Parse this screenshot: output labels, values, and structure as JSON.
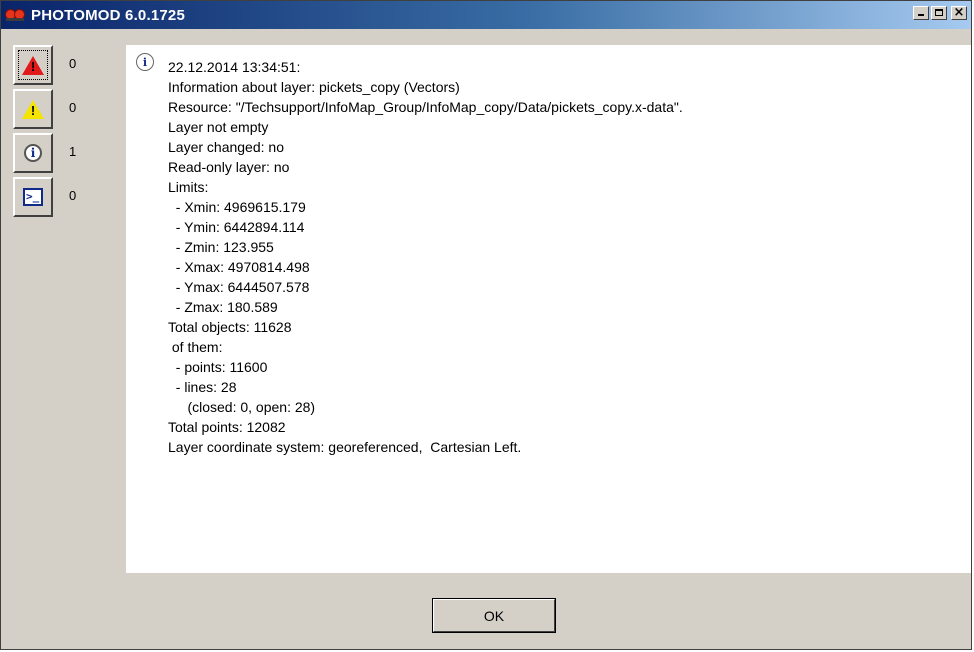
{
  "window": {
    "title": "PHOTOMOD 6.0.1725",
    "app_icon": "photomod-logo-icon",
    "controls": {
      "minimize_icon": "minimize-icon",
      "maximize_icon": "maximize-icon",
      "close_glyph": "×"
    }
  },
  "sidebar": {
    "filters": [
      {
        "name": "errors",
        "icon": "error-triangle-icon",
        "count": "0",
        "color": "#e01a1a"
      },
      {
        "name": "warnings",
        "icon": "warning-triangle-icon",
        "count": "0",
        "color": "#f4e400"
      },
      {
        "name": "info",
        "icon": "info-icon",
        "glyph": "i",
        "count": "1"
      },
      {
        "name": "console",
        "icon": "console-icon",
        "glyph": ">_",
        "count": "0"
      }
    ]
  },
  "log": {
    "entry_icon": "info-icon",
    "lines": [
      "22.12.2014 13:34:51:",
      "Information about layer: pickets_copy (Vectors)",
      "Resource: \"/Techsupport/InfoMap_Group/InfoMap_copy/Data/pickets_copy.x-data\".",
      "Layer not empty",
      "Layer changed: no",
      "Read-only layer: no",
      "Limits:",
      "  - Xmin: 4969615.179",
      "  - Ymin: 6442894.114",
      "  - Zmin: 123.955",
      "  - Xmax: 4970814.498",
      "  - Ymax: 6444507.578",
      "  - Zmax: 180.589",
      "Total objects: 11628",
      " of them:",
      "  - points: 11600",
      "  - lines: 28",
      "     (closed: 0, open: 28)",
      "Total points: 12082",
      "Layer coordinate system: georeferenced,  Cartesian Left."
    ]
  },
  "footer": {
    "ok_label": "OK"
  }
}
